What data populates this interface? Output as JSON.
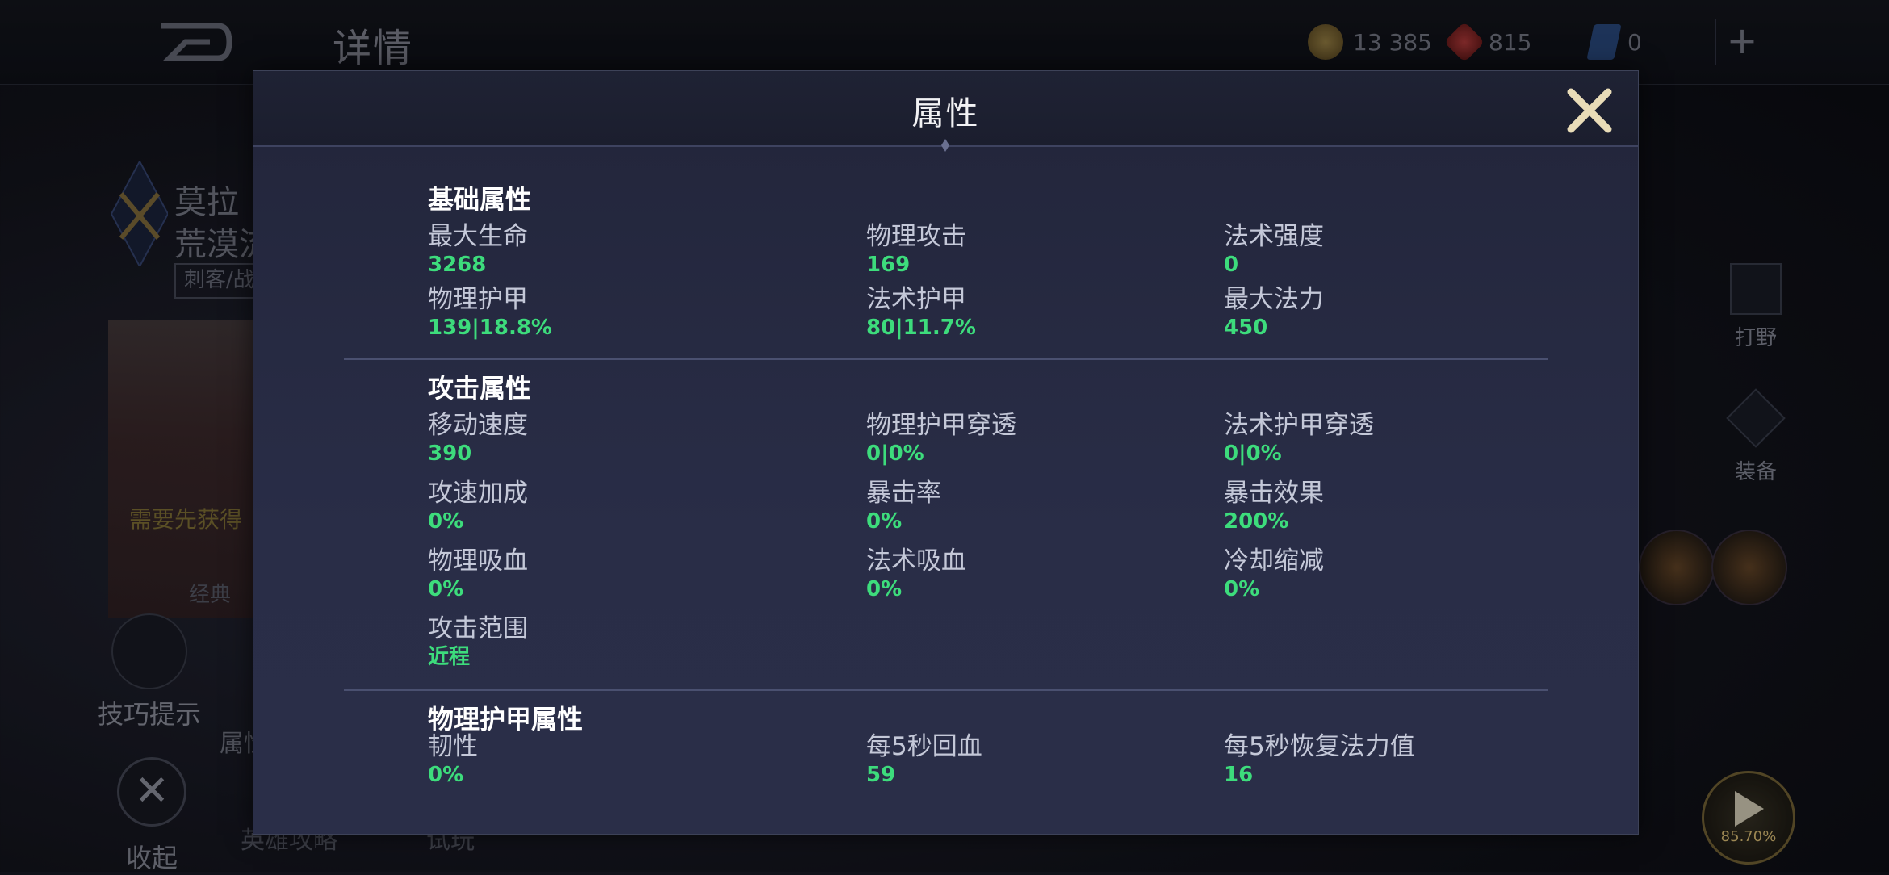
{
  "topbar": {
    "title": "详情",
    "gold": "13 385",
    "gems": "815",
    "tickets": "0",
    "plus": "+"
  },
  "hero": {
    "name": "莫拉",
    "subtitle": "荒漠流",
    "tag": "刺客/战",
    "need_text": "需要先获得",
    "classic": "经典",
    "tips_label": "技巧提示",
    "attr_label": "属性",
    "collapse_label": "收起",
    "guide_label": "英雄攻略",
    "trial_label": "试玩"
  },
  "right_panel": {
    "jungle_label": "打野",
    "equip_label": "装备",
    "play_progress": "85.70%"
  },
  "modal": {
    "title": "属性",
    "sections": [
      {
        "title": "基础属性",
        "stats": [
          {
            "label": "最大生命",
            "value": "3268"
          },
          {
            "label": "物理攻击",
            "value": "169"
          },
          {
            "label": "法术强度",
            "value": "0"
          },
          {
            "label": "物理护甲",
            "value": "139|18.8%"
          },
          {
            "label": "法术护甲",
            "value": "80|11.7%"
          },
          {
            "label": "最大法力",
            "value": "450"
          }
        ]
      },
      {
        "title": "攻击属性",
        "stats": [
          {
            "label": "移动速度",
            "value": "390"
          },
          {
            "label": "物理护甲穿透",
            "value": "0|0%"
          },
          {
            "label": "法术护甲穿透",
            "value": "0|0%"
          },
          {
            "label": "攻速加成",
            "value": "0%"
          },
          {
            "label": "暴击率",
            "value": "0%"
          },
          {
            "label": "暴击效果",
            "value": "200%"
          },
          {
            "label": "物理吸血",
            "value": "0%"
          },
          {
            "label": "法术吸血",
            "value": "0%"
          },
          {
            "label": "冷却缩减",
            "value": "0%"
          },
          {
            "label": "攻击范围",
            "value": "近程"
          }
        ]
      },
      {
        "title": "物理护甲属性",
        "stats": [
          {
            "label": "韧性",
            "value": "0%"
          },
          {
            "label": "每5秒回血",
            "value": "59"
          },
          {
            "label": "每5秒恢复法力值",
            "value": "16"
          }
        ]
      }
    ]
  },
  "colors": {
    "stat_value": "#3ddc7c",
    "modal_bg": "#292d47",
    "close_icon": "#e9dcb8"
  }
}
